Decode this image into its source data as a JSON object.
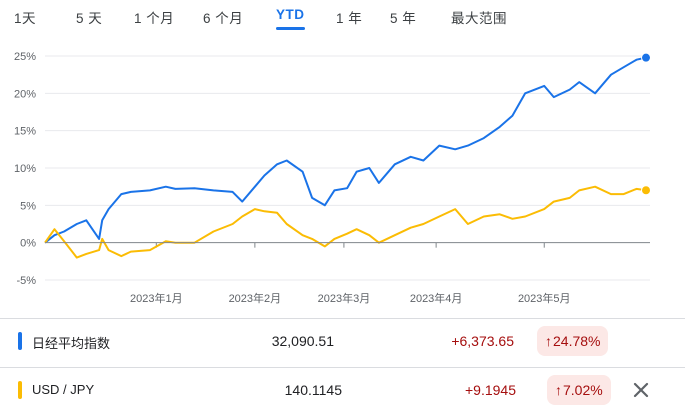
{
  "tabs": [
    "1天",
    "5 天",
    "1 个月",
    "6 个月",
    "YTD",
    "1 年",
    "5 年",
    "最大范围"
  ],
  "active_tab": "YTD",
  "colors": {
    "series1": "#1a73e8",
    "series2": "#fbbc04",
    "accent": "#1a73e8",
    "negative": "#a50e0e",
    "negative_bg": "#fce8e6"
  },
  "rows": [
    {
      "name": "日经平均指数",
      "value": "32,090.51",
      "change": "+6,373.65",
      "percent": "24.78%",
      "arrow": "up-arrow-icon"
    },
    {
      "name": "USD / JPY",
      "value": "140.1145",
      "change": "+9.1945",
      "percent": "7.02%",
      "arrow": "up-arrow-icon"
    }
  ],
  "close_icon": "close-icon",
  "chart_data": {
    "type": "line",
    "x_tick_labels": [
      "2023年1月",
      "2023年2月",
      "2023年3月",
      "2023年4月",
      "2023年5月"
    ],
    "y_tick_labels": [
      "25%",
      "20%",
      "15%",
      "10%",
      "5%",
      "0%",
      "-5%"
    ],
    "ylim": [
      -5,
      25
    ],
    "grid": true,
    "baseline": 0,
    "series": [
      {
        "name": "日经平均指数",
        "color": "#1a73e8",
        "x": [
          "2022-12-02",
          "2022-12-05",
          "2022-12-08",
          "2022-12-12",
          "2022-12-15",
          "2022-12-19",
          "2022-12-20",
          "2022-12-22",
          "2022-12-26",
          "2022-12-29",
          "2023-01-04",
          "2023-01-09",
          "2023-01-12",
          "2023-01-18",
          "2023-01-24",
          "2023-01-30",
          "2023-02-02",
          "2023-02-06",
          "2023-02-09",
          "2023-02-13",
          "2023-02-16",
          "2023-02-21",
          "2023-02-24",
          "2023-02-28",
          "2023-03-03",
          "2023-03-07",
          "2023-03-10",
          "2023-03-14",
          "2023-03-17",
          "2023-03-22",
          "2023-03-27",
          "2023-03-31",
          "2023-04-05",
          "2023-04-10",
          "2023-04-14",
          "2023-04-19",
          "2023-04-24",
          "2023-04-28",
          "2023-05-02",
          "2023-05-08",
          "2023-05-11",
          "2023-05-16",
          "2023-05-19",
          "2023-05-24",
          "2023-05-29",
          "2023-06-02",
          "2023-06-06",
          "2023-06-09"
        ],
        "y": [
          0.0,
          1.0,
          1.5,
          2.5,
          3.0,
          0.5,
          3.0,
          4.5,
          6.5,
          6.8,
          7.0,
          7.5,
          7.2,
          7.3,
          7.0,
          6.8,
          5.5,
          7.5,
          9.0,
          10.5,
          11.0,
          9.5,
          6.0,
          5.0,
          7.0,
          7.3,
          9.5,
          10.0,
          8.0,
          10.5,
          11.5,
          11.0,
          13.0,
          12.5,
          13.0,
          14.0,
          15.5,
          17.0,
          20.0,
          21.0,
          19.5,
          20.5,
          21.5,
          20.0,
          22.5,
          23.5,
          24.5,
          24.78
        ]
      },
      {
        "name": "USD / JPY",
        "color": "#fbbc04",
        "x": [
          "2022-12-02",
          "2022-12-05",
          "2022-12-08",
          "2022-12-12",
          "2022-12-15",
          "2022-12-19",
          "2022-12-20",
          "2022-12-22",
          "2022-12-26",
          "2022-12-29",
          "2023-01-04",
          "2023-01-09",
          "2023-01-12",
          "2023-01-18",
          "2023-01-24",
          "2023-01-30",
          "2023-02-02",
          "2023-02-06",
          "2023-02-09",
          "2023-02-13",
          "2023-02-16",
          "2023-02-21",
          "2023-02-24",
          "2023-02-28",
          "2023-03-03",
          "2023-03-07",
          "2023-03-10",
          "2023-03-14",
          "2023-03-17",
          "2023-03-22",
          "2023-03-27",
          "2023-03-31",
          "2023-04-05",
          "2023-04-10",
          "2023-04-14",
          "2023-04-19",
          "2023-04-24",
          "2023-04-28",
          "2023-05-02",
          "2023-05-08",
          "2023-05-11",
          "2023-05-16",
          "2023-05-19",
          "2023-05-24",
          "2023-05-29",
          "2023-06-02",
          "2023-06-06",
          "2023-06-09"
        ],
        "y": [
          0.0,
          1.8,
          0.2,
          -2.0,
          -1.5,
          -1.0,
          0.5,
          -1.0,
          -1.8,
          -1.2,
          -1.0,
          0.2,
          0.0,
          0.0,
          1.5,
          2.5,
          3.5,
          4.5,
          4.2,
          4.0,
          2.5,
          1.0,
          0.5,
          -0.5,
          0.5,
          1.2,
          1.8,
          1.0,
          0.0,
          1.0,
          2.0,
          2.5,
          3.5,
          4.5,
          2.5,
          3.5,
          3.8,
          3.2,
          3.5,
          4.5,
          5.5,
          6.0,
          7.0,
          7.5,
          6.5,
          6.5,
          7.2,
          7.02
        ]
      }
    ]
  }
}
